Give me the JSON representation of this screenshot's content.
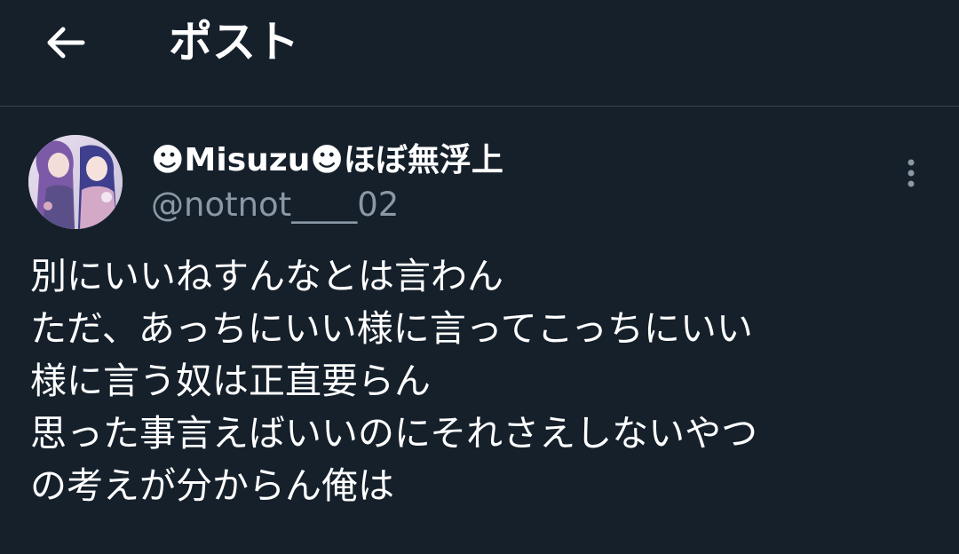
{
  "header": {
    "title": "ポスト",
    "back_icon": "arrow-left-icon"
  },
  "tweet": {
    "display_name": "☻Misuzu☻ほぼ無浮上",
    "handle": "@notnot____02",
    "more_icon": "more-vertical-icon",
    "lines": [
      "別にいいねすんなとは言わん",
      "ただ、あっちにいい様に言ってこっちにいい",
      "様に言う奴は正直要らん",
      "思った事言えばいいのにそれさえしないやつ",
      "の考えが分からん俺は"
    ]
  },
  "colors": {
    "background": "#15202b",
    "divider": "#38444d",
    "primary_text": "#ffffff",
    "secondary_text": "#8b98a5"
  }
}
